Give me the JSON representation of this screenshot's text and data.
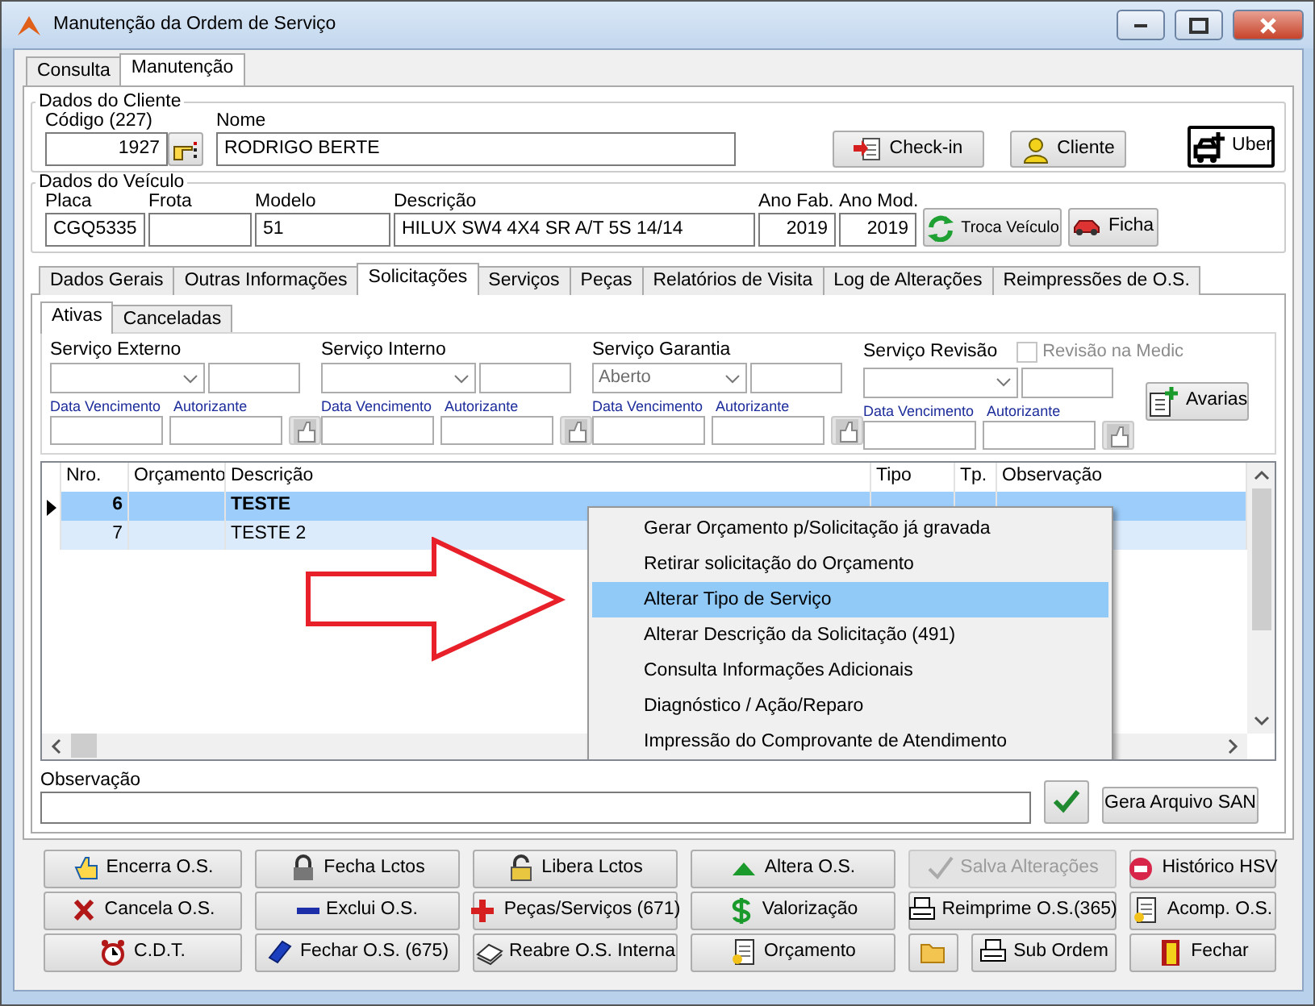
{
  "window": {
    "title": "Manutenção da Ordem de Serviço"
  },
  "main_tabs": [
    {
      "label": "Consulta",
      "selected": false
    },
    {
      "label": "Manutenção",
      "selected": true
    }
  ],
  "cliente": {
    "section": "Dados do Cliente",
    "codigo_label": "Código (227)",
    "codigo": "1927",
    "nome_label": "Nome",
    "nome": "RODRIGO BERTE"
  },
  "cliente_buttons": [
    {
      "label": "Check-in"
    },
    {
      "label": "Cliente"
    },
    {
      "label": "Uber"
    }
  ],
  "veiculo": {
    "section": "Dados do Veículo",
    "fields": [
      {
        "label": "Placa",
        "value": "CGQ5335"
      },
      {
        "label": "Frota"
      },
      {
        "label": "Modelo",
        "value": "51"
      },
      {
        "label": "Descrição",
        "value": "HILUX SW4 4X4 SR A/T 5S 14/14"
      },
      {
        "label": "Ano Fab.",
        "value": "2019"
      },
      {
        "label": "Ano Mod.",
        "value": "2019"
      }
    ]
  },
  "veiculo_buttons": [
    {
      "label": "Troca Veículo"
    },
    {
      "label": "Ficha"
    }
  ],
  "detail_tabs": [
    {
      "label": "Dados Gerais",
      "selected": false
    },
    {
      "label": "Outras Informações",
      "selected": false
    },
    {
      "label": "Solicitações",
      "selected": true
    },
    {
      "label": "Serviços",
      "selected": false
    },
    {
      "label": "Peças",
      "selected": false
    },
    {
      "label": "Relatórios de Visita",
      "selected": false
    },
    {
      "label": "Log de Alterações",
      "selected": false
    },
    {
      "label": "Reimpressões de O.S.",
      "selected": false
    }
  ],
  "sub_tabs": [
    {
      "label": "Ativas",
      "selected": true
    },
    {
      "label": "Canceladas",
      "selected": false
    }
  ],
  "services": [
    {
      "label": "Serviço Externo",
      "date_label": "Data Vencimento",
      "auth_label": "Autorizante"
    },
    {
      "label": "Serviço Interno",
      "date_label": "Data Vencimento",
      "auth_label": "Autorizante"
    },
    {
      "label": "Serviço Garantia",
      "value": "Aberto",
      "date_label": "Data Vencimento",
      "auth_label": "Autorizante"
    },
    {
      "label": "Serviço Revisão",
      "date_label": "Data Vencimento",
      "auth_label": "Autorizante"
    }
  ],
  "revisao": {
    "label": "Revisão na Medic",
    "checked": false,
    "disabled": true
  },
  "avarias_button": {
    "label": "Avarias"
  },
  "grid": {
    "columns": [
      "Nro.",
      "Orçamento",
      "Descrição",
      "Tipo",
      "Tp.",
      "Observação"
    ],
    "rows": [
      {
        "nro": "6",
        "descricao": "TESTE",
        "selected": true
      },
      {
        "nro": "7",
        "descricao": "TESTE 2",
        "selected": false
      }
    ]
  },
  "context_menu": [
    {
      "label": "Gerar Orçamento p/Solicitação já gravada",
      "selected": false
    },
    {
      "label": "Retirar solicitação do Orçamento",
      "selected": false
    },
    {
      "label": "Alterar Tipo de Serviço",
      "selected": true
    },
    {
      "label": "Alterar Descrição da Solicitação (491)",
      "selected": false
    },
    {
      "label": "Consulta Informações Adicionais",
      "selected": false
    },
    {
      "label": "Diagnóstico / Ação/Reparo",
      "selected": false
    },
    {
      "label": "Impressão do Comprovante de Atendimento",
      "selected": false
    }
  ],
  "observacao": {
    "label": "Observação"
  },
  "gera_button": {
    "label": "Gera Arquivo SAN"
  },
  "bottom_buttons": [
    [
      {
        "kind": "text",
        "label": "Encerra O.S.",
        "disabled": false
      },
      {
        "kind": "text",
        "label": "Fecha Lctos",
        "disabled": false
      },
      {
        "kind": "text",
        "label": "Libera Lctos",
        "disabled": false
      },
      {
        "kind": "text",
        "label": "Altera O.S.",
        "disabled": false
      },
      {
        "kind": "text",
        "label": "Salva Alterações",
        "disabled": true
      },
      {
        "kind": "text",
        "label": "Histórico HSV",
        "disabled": false
      }
    ],
    [
      {
        "kind": "text",
        "label": "Cancela O.S.",
        "disabled": false
      },
      {
        "kind": "text",
        "label": "Exclui O.S.",
        "disabled": false
      },
      {
        "kind": "text",
        "label": "Peças/Serviços (671)",
        "disabled": false
      },
      {
        "kind": "text",
        "label": "Valorização",
        "disabled": false
      },
      {
        "kind": "text",
        "label": "Reimprime O.S.(365)",
        "disabled": false
      },
      {
        "kind": "text",
        "label": "Acomp. O.S.",
        "disabled": false
      }
    ],
    [
      {
        "kind": "text",
        "label": "C.D.T.",
        "disabled": false
      },
      {
        "kind": "text",
        "label": "Fechar O.S. (675)",
        "disabled": false
      },
      {
        "kind": "text",
        "label": "Reabre O.S. Interna",
        "disabled": false
      },
      {
        "kind": "text",
        "label": "Orçamento",
        "disabled": false
      },
      {
        "kind": "icon",
        "disabled": false
      },
      {
        "kind": "text",
        "label": "Sub Ordem",
        "disabled": false
      },
      {
        "kind": "text",
        "label": "Fechar",
        "disabled": false
      }
    ]
  ]
}
